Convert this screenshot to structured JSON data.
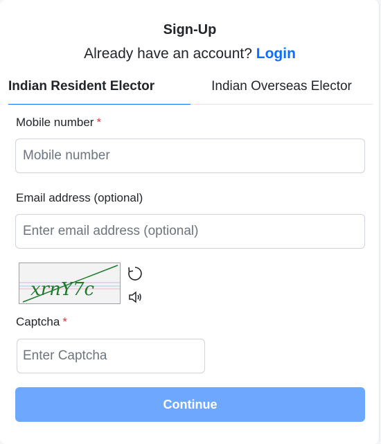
{
  "header": {
    "title": "Sign-Up",
    "subtitle_prefix": "Already have an account?",
    "login_link": "Login"
  },
  "tabs": [
    {
      "label": "Indian Resident Elector",
      "active": true
    },
    {
      "label": "Indian Overseas Elector",
      "active": false
    }
  ],
  "form": {
    "mobile": {
      "label": "Mobile number",
      "required_mark": "*",
      "placeholder": "Mobile number",
      "value": ""
    },
    "email": {
      "label": "Email address (optional)",
      "placeholder": "Enter email address (optional)",
      "value": ""
    },
    "captcha": {
      "image_text": "xrnY7c",
      "label": "Captcha",
      "required_mark": "*",
      "placeholder": "Enter Captcha",
      "value": ""
    },
    "continue_label": "Continue"
  },
  "icons": {
    "refresh": "refresh-icon",
    "audio": "speaker-icon"
  },
  "colors": {
    "link": "#0d6efd",
    "button": "#6ea8fe",
    "required": "#dc3545",
    "captcha_text": "#1f7a2e"
  }
}
